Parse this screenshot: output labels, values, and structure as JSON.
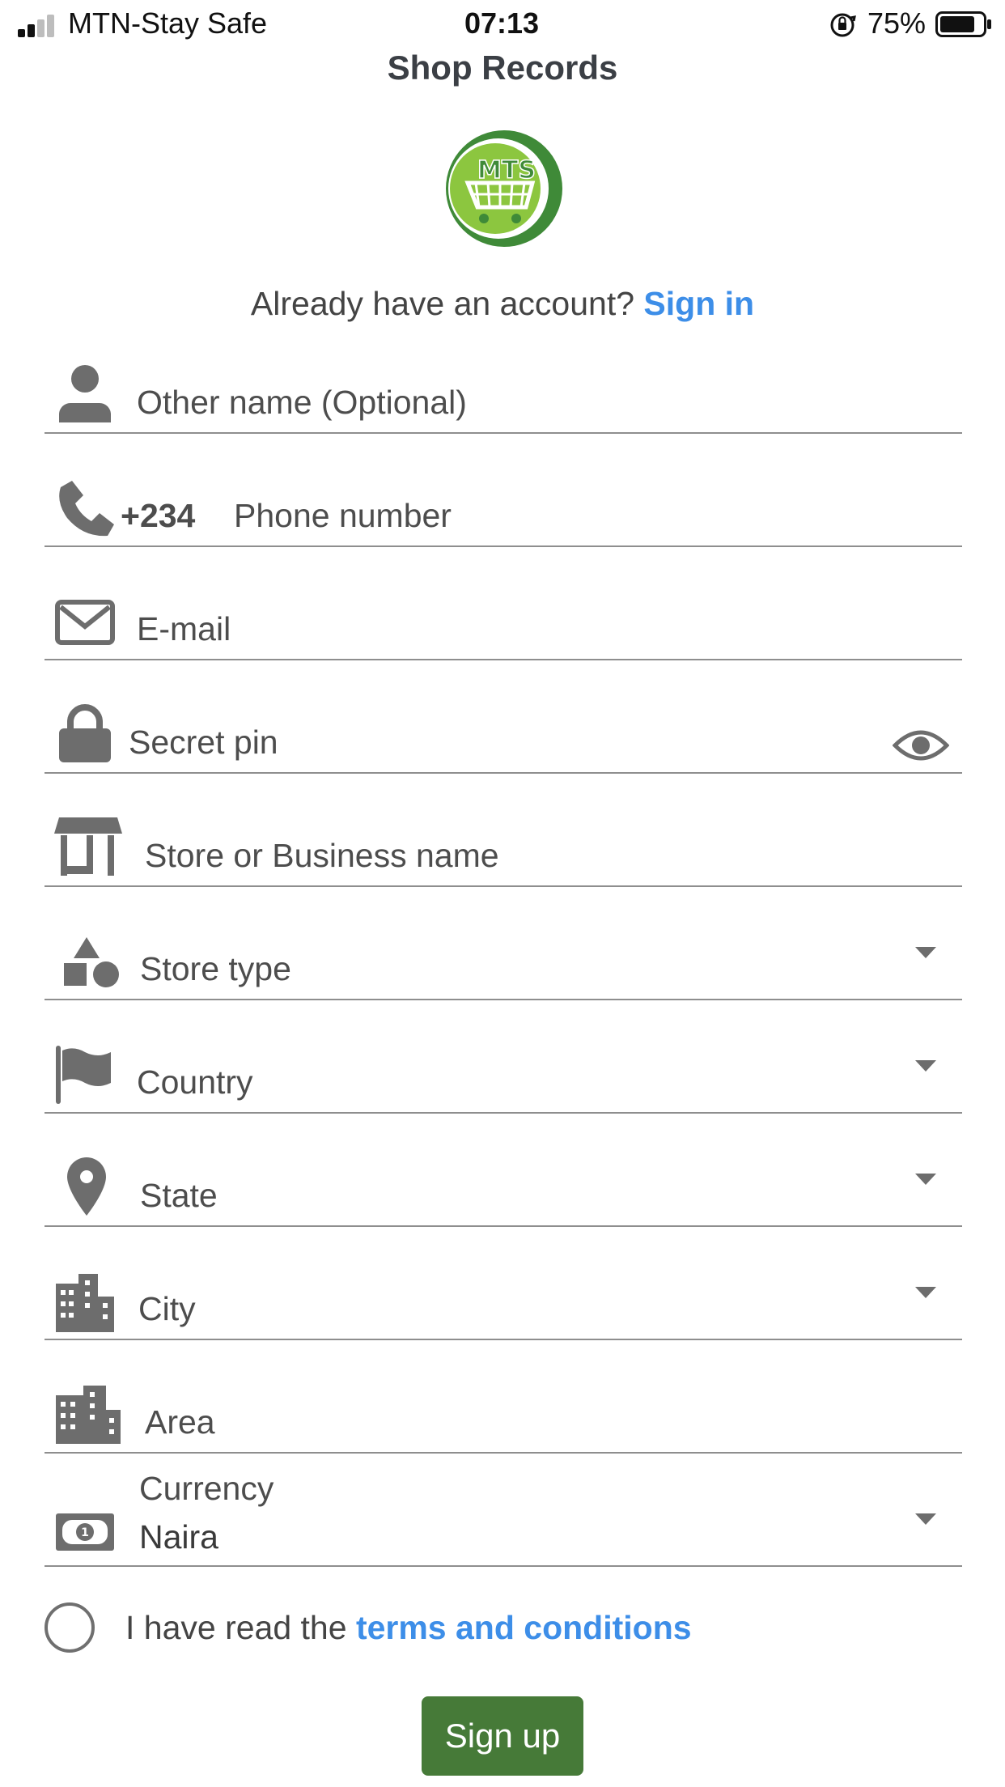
{
  "status_bar": {
    "carrier": "MTN-Stay Safe",
    "time": "07:13",
    "battery_percent": "75%",
    "signal_bars": 2,
    "battery_level": 0.75
  },
  "header": {
    "title": "Shop Records"
  },
  "logo": {
    "text": "MTS",
    "colors": {
      "ring": "#3f8a38",
      "inner": "#8cc63f"
    }
  },
  "account": {
    "prompt": "Already have an account?",
    "sign_in": "Sign in"
  },
  "form": {
    "other_name": {
      "placeholder": "Other name (Optional)",
      "icon": "person-icon"
    },
    "phone": {
      "prefix": "+234",
      "placeholder": "Phone number",
      "icon": "phone-icon"
    },
    "email": {
      "placeholder": "E-mail",
      "icon": "envelope-icon"
    },
    "pin": {
      "placeholder": "Secret pin",
      "icon": "lock-icon",
      "toggle_icon": "eye-icon"
    },
    "store_name": {
      "placeholder": "Store or Business name",
      "icon": "store-icon"
    },
    "store_type": {
      "placeholder": "Store type",
      "icon": "shapes-icon"
    },
    "country": {
      "placeholder": "Country",
      "icon": "flag-icon"
    },
    "state": {
      "placeholder": "State",
      "icon": "map-pin-icon"
    },
    "city": {
      "placeholder": "City",
      "icon": "city-icon"
    },
    "area": {
      "placeholder": "Area",
      "icon": "buildings-icon"
    },
    "currency": {
      "label": "Currency",
      "value": "Naira",
      "icon": "money-icon"
    }
  },
  "terms": {
    "prefix": "I have read the",
    "link": "terms and conditions",
    "checked": false
  },
  "signup": {
    "label": "Sign up"
  },
  "colors": {
    "link": "#3d8ee8",
    "button": "#467a38",
    "icon": "#6d6d6d"
  }
}
